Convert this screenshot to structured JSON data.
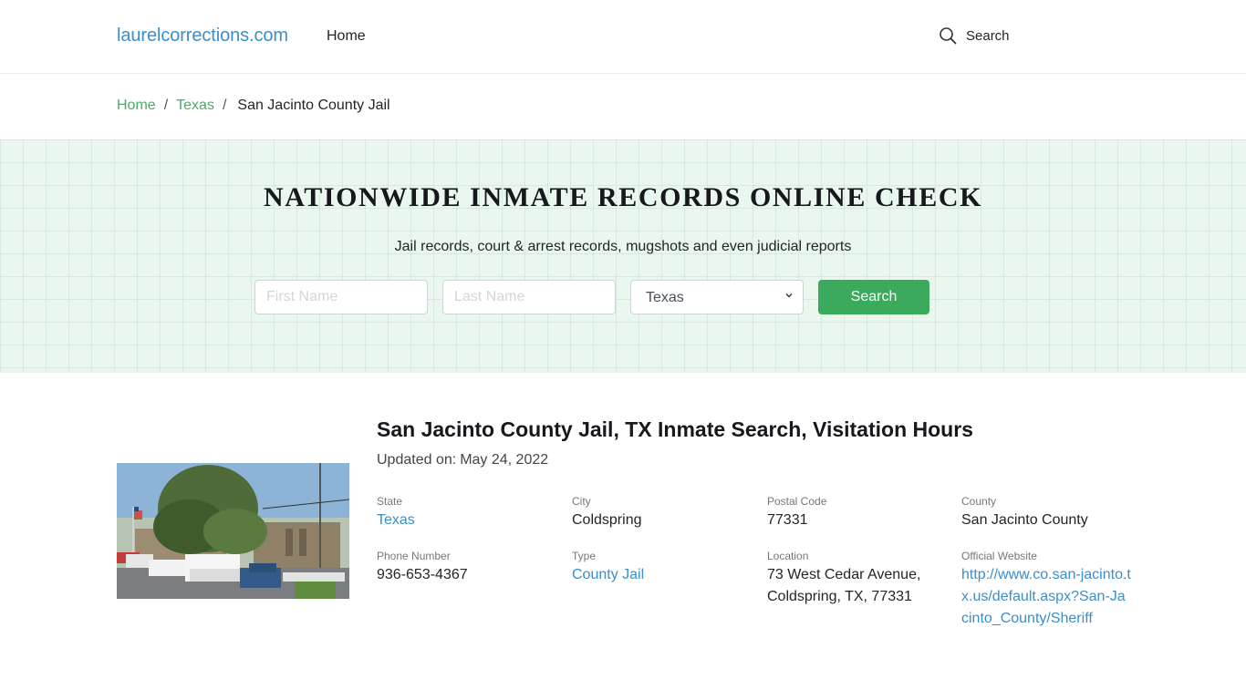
{
  "header": {
    "brand": "laurelcorrections.com",
    "nav": [
      {
        "label": "Home"
      }
    ],
    "search_label": "Search",
    "search_icon": "search-icon"
  },
  "breadcrumb": {
    "items": [
      {
        "label": "Home",
        "link": true
      },
      {
        "label": "Texas",
        "link": true
      },
      {
        "label": "San Jacinto County Jail",
        "link": false
      }
    ],
    "separator": "/"
  },
  "hero": {
    "title": "NATIONWIDE INMATE RECORDS ONLINE CHECK",
    "subtitle": "Jail records, court & arrest records, mugshots and even judicial reports",
    "first_name_placeholder": "First Name",
    "last_name_placeholder": "Last Name",
    "state_selected": "Texas",
    "search_button": "Search"
  },
  "facility": {
    "title": "San Jacinto County Jail, TX Inmate Search, Visitation Hours",
    "updated_label": "Updated on:",
    "updated_date": "May 24, 2022",
    "photo_alt": "San Jacinto County Jail building photo",
    "fields": {
      "state": {
        "label": "State",
        "value": "Texas"
      },
      "city": {
        "label": "City",
        "value": "Coldspring"
      },
      "postal_code": {
        "label": "Postal Code",
        "value": "77331"
      },
      "county": {
        "label": "County",
        "value": "San Jacinto County"
      },
      "phone": {
        "label": "Phone Number",
        "value": "936-653-4367"
      },
      "type": {
        "label": "Type",
        "value": "County Jail"
      },
      "location": {
        "label": "Location",
        "value_line1": "73 West Cedar Avenue,",
        "value_line2": "Coldspring, TX, 77331"
      },
      "website": {
        "label": "Official Website",
        "value": "http://www.co.san-jacinto.tx.us/default.aspx?San-Jacinto_County/Sheriff"
      }
    }
  },
  "colors": {
    "brand_blue": "#3d8dc8",
    "breadcrumb_green": "#4caa6a",
    "button_green": "#3caa5c",
    "hero_bg": "#eaf7ef"
  }
}
